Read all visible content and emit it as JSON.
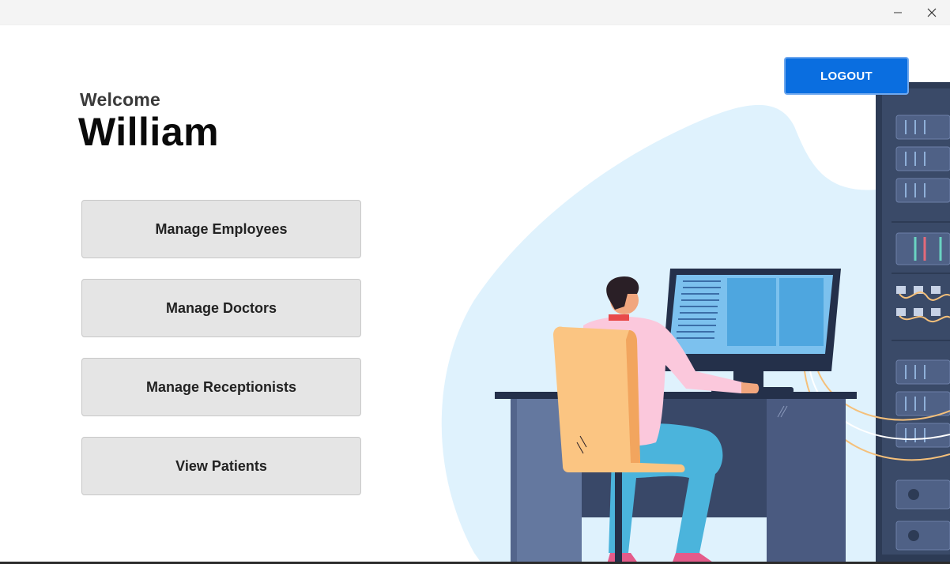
{
  "window": {
    "controls": [
      "minimize-icon",
      "close-icon"
    ]
  },
  "greeting": {
    "welcome": "Welcome",
    "name": "William"
  },
  "menu": {
    "employees": "Manage Employees",
    "doctors": "Manage Doctors",
    "receptionists": "Manage Receptionists",
    "patients": "View Patients"
  },
  "header": {
    "logout_label": "LOGOUT"
  },
  "colors": {
    "accent": "#0a6ee0",
    "button_bg": "#e5e5e5",
    "blob": "#dff2fd"
  },
  "illustration": {
    "subject": "person-at-computer-illustration"
  }
}
